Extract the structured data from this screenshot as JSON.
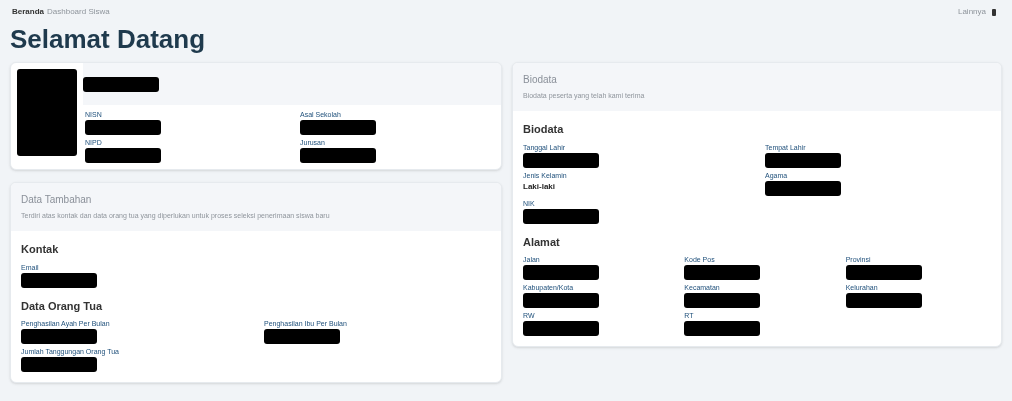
{
  "breadcrumb": {
    "items": [
      "Beranda",
      "Dashboard Siswa"
    ]
  },
  "top_right": {
    "label": "Lainnya"
  },
  "title": "Selamat Datang",
  "profile_card": {
    "fields": [
      {
        "label": "NISN"
      },
      {
        "label": "Asal Sekolah"
      },
      {
        "label": "NIPD"
      },
      {
        "label": "Jurusan"
      }
    ]
  },
  "extra_card": {
    "title": "Data Tambahan",
    "subtitle": "Terdiri atas kontak dan data orang tua yang diperlukan untuk proses seleksi penerimaan siswa baru",
    "sections": [
      {
        "heading": "Kontak",
        "fields": [
          {
            "label": "Email"
          }
        ]
      },
      {
        "heading": "Data Orang Tua",
        "fields": [
          {
            "label": "Penghasilan Ayah Per Bulan"
          },
          {
            "label": "Penghasilan Ibu Per Bulan"
          },
          {
            "label": "Jumlah Tanggungan Orang Tua"
          }
        ]
      }
    ]
  },
  "bio_card": {
    "title": "Biodata",
    "subtitle": "Biodata peserta yang telah kami terima",
    "sections": [
      {
        "heading": "Biodata",
        "fields": [
          {
            "label": "Tanggal Lahir"
          },
          {
            "label": "Tempat Lahir"
          },
          {
            "label": "Jenis Kelamin",
            "value": "Laki-laki"
          },
          {
            "label": "Agama"
          },
          {
            "label": "NIK"
          }
        ]
      },
      {
        "heading": "Alamat",
        "fields": [
          {
            "label": "Jalan"
          },
          {
            "label": "Kode Pos"
          },
          {
            "label": "Provinsi"
          },
          {
            "label": "Kabupaten/Kota"
          },
          {
            "label": "Kecamatan"
          },
          {
            "label": "Kelurahan"
          },
          {
            "label": "RW"
          },
          {
            "label": "RT"
          }
        ]
      }
    ]
  }
}
